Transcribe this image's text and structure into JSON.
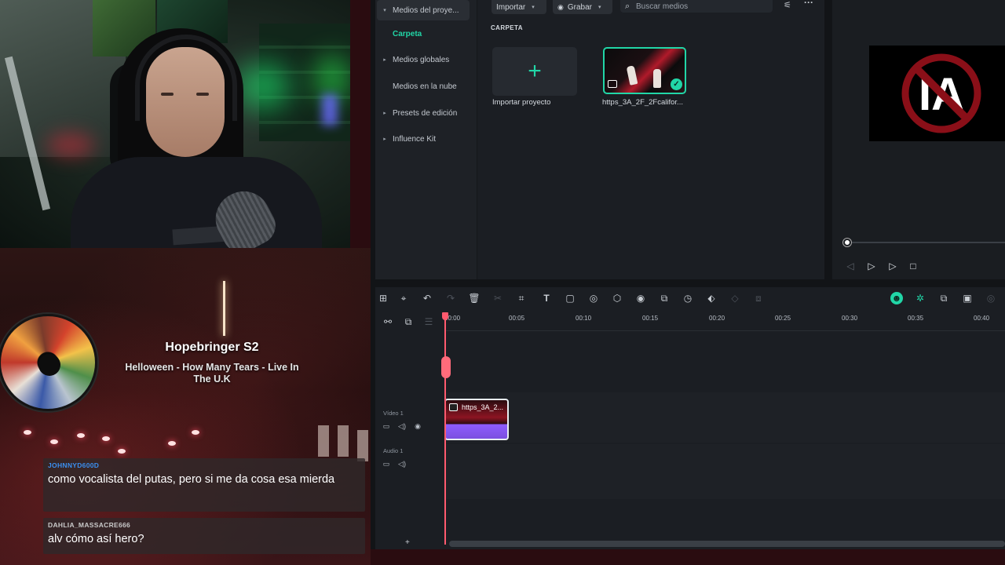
{
  "now_playing": {
    "title": "Hopebringer S2",
    "subtitle": "Helloween - How Many Tears - Live In The U.K"
  },
  "chat": [
    {
      "user": "JOHNNYD600D",
      "user_color": "#3b8ff0",
      "message": "como vocalista del putas, pero si me da cosa esa mierda"
    },
    {
      "user": "DAHLIA_MASSACRE666",
      "user_color": "#c9c9c9",
      "message": "alv cómo así hero?"
    }
  ],
  "editor": {
    "accent": "#21d6a7",
    "sidebar": [
      {
        "label": "Medios del proye...",
        "caret": "▾",
        "active": false
      },
      {
        "label": "Carpeta",
        "caret": "",
        "active": true
      },
      {
        "label": "Medios globales",
        "caret": "▸",
        "active": false
      },
      {
        "label": "Medios en la nube",
        "caret": "",
        "active": false
      },
      {
        "label": "Presets de edición",
        "caret": "▸",
        "active": false
      },
      {
        "label": "Influence Kit",
        "caret": "▸",
        "active": false
      }
    ],
    "toolbar": {
      "import_label": "Importar",
      "record_label": "Grabar",
      "search_placeholder": "Buscar medios"
    },
    "folder_heading": "CARPETA",
    "tiles": {
      "import_label": "Importar proyecto",
      "clip_label": "https_3A_2F_2Fcalifor..."
    },
    "preview": {
      "overlay_text": "IA"
    },
    "timeline": {
      "ruler_labels": [
        "00:00",
        "00:05",
        "00:10",
        "00:15",
        "00:20",
        "00:25",
        "00:30",
        "00:35",
        "00:40"
      ],
      "video_track_label": "Vídeo 1",
      "audio_track_label": "Audio 1",
      "clip_label": "https_3A_2..."
    }
  }
}
